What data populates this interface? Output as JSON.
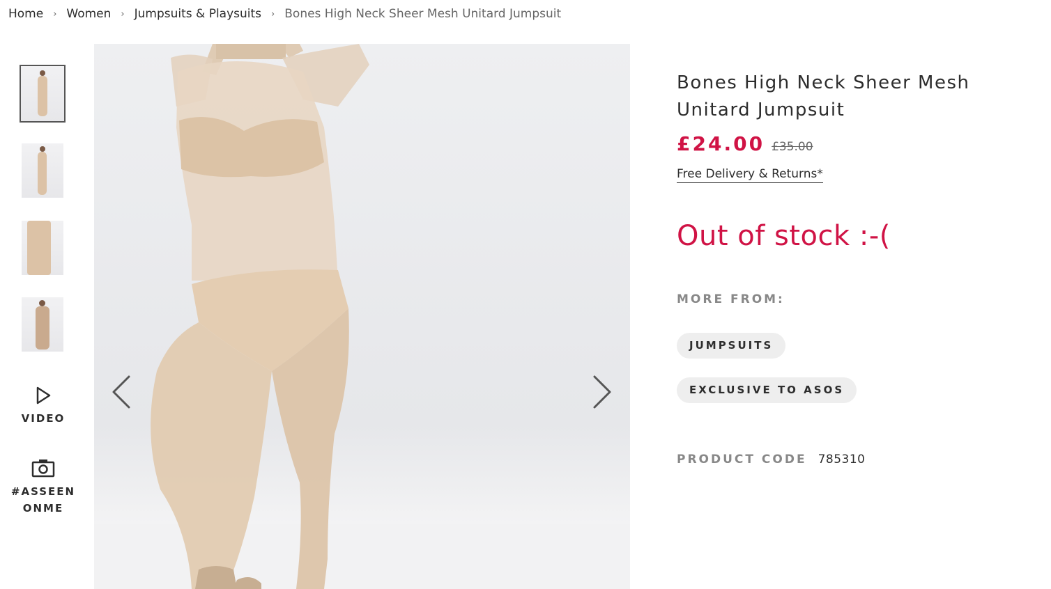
{
  "breadcrumb": {
    "home": "Home",
    "women": "Women",
    "category": "Jumpsuits & Playsuits",
    "current": "Bones High Neck Sheer Mesh Unitard Jumpsuit",
    "separator": "›"
  },
  "gallery": {
    "thumbnail_count": 4,
    "active_thumbnail": 1,
    "video_label": "VIDEO",
    "asseenonme_label_line1": "#ASSEEN",
    "asseenonme_label_line2": "ONME",
    "prev_icon": "chevron-left-icon",
    "next_icon": "chevron-right-icon"
  },
  "product": {
    "title": "Bones High Neck Sheer Mesh Unitard Jumpsuit",
    "price_now": "£24.00",
    "price_was": "£35.00",
    "delivery_link": "Free Delivery & Returns*",
    "stock_status": "Out of stock :-(",
    "more_from_label": "MORE FROM:",
    "more_from_tags": [
      "JUMPSUITS",
      "EXCLUSIVE TO ASOS"
    ],
    "product_code_label": "PRODUCT CODE",
    "product_code": "785310"
  },
  "colors": {
    "accent": "#d01345",
    "text": "#2d2d2d",
    "muted": "#888888",
    "pill_bg": "#eeeeee"
  }
}
